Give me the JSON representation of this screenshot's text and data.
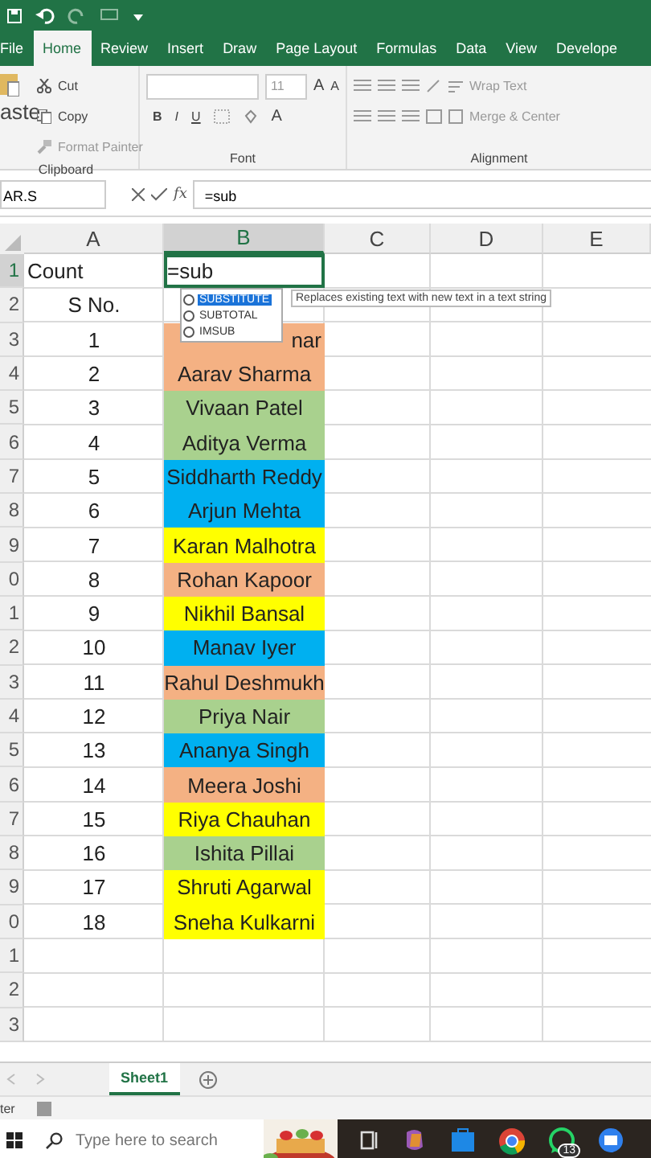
{
  "tabs": [
    {
      "label": "File",
      "selected": false
    },
    {
      "label": "Home",
      "selected": true
    },
    {
      "label": "Review",
      "selected": false
    },
    {
      "label": "Insert",
      "selected": false
    },
    {
      "label": "Draw",
      "selected": false
    },
    {
      "label": "Page Layout",
      "selected": false
    },
    {
      "label": "Formulas",
      "selected": false
    },
    {
      "label": "Data",
      "selected": false
    },
    {
      "label": "View",
      "selected": false
    },
    {
      "label": "Develope",
      "selected": false
    }
  ],
  "ribbon": {
    "paste": "aste",
    "cut": "Cut",
    "copy": "Copy",
    "format_painter": "Format Painter",
    "clipboard_label": "Clipboard",
    "font_size": "11",
    "bold": "B",
    "italic": "I",
    "underline": "U",
    "font_color": "A",
    "grow": "A",
    "shrink": "A",
    "font_label": "Font",
    "wrap": "Wrap Text",
    "merge": "Merge & Center",
    "alignment_label": "Alignment"
  },
  "formula_bar": {
    "name_box": "AR.S",
    "fx": "fx",
    "value": "=sub"
  },
  "columns": [
    {
      "label": "A",
      "selected": false
    },
    {
      "label": "B",
      "selected": true
    },
    {
      "label": "C",
      "selected": false
    },
    {
      "label": "D",
      "selected": false
    },
    {
      "label": "E",
      "selected": false
    }
  ],
  "rows": [
    {
      "number": "1",
      "selected": true,
      "a": "Count",
      "b": "=sub",
      "editing": true
    },
    {
      "number": "2",
      "selected": false,
      "a": "S No."
    },
    {
      "number": "3",
      "selected": false,
      "a": "1",
      "b": "nar",
      "color": "#f4b183",
      "partly_hidden": true
    },
    {
      "number": "4",
      "selected": false,
      "a": "2",
      "b": "Aarav Sharma",
      "color": "#f4b183"
    },
    {
      "number": "5",
      "selected": false,
      "a": "3",
      "b": "Vivaan Patel",
      "color": "#a9d18e"
    },
    {
      "number": "6",
      "selected": false,
      "a": "4",
      "b": "Aditya Verma",
      "color": "#a9d18e"
    },
    {
      "number": "7",
      "selected": false,
      "a": "5",
      "b": "Siddharth Reddy",
      "color": "#00b0f0"
    },
    {
      "number": "8",
      "selected": false,
      "a": "6",
      "b": "Arjun Mehta",
      "color": "#00b0f0"
    },
    {
      "number": "9",
      "selected": false,
      "a": "7",
      "b": "Karan Malhotra",
      "color": "#ffff00"
    },
    {
      "number": "0",
      "selected": false,
      "a": "8",
      "b": "Rohan Kapoor",
      "color": "#f4b183"
    },
    {
      "number": "1",
      "selected": false,
      "a": "9",
      "b": "Nikhil Bansal",
      "color": "#ffff00"
    },
    {
      "number": "2",
      "selected": false,
      "a": "10",
      "b": "Manav Iyer",
      "color": "#00b0f0"
    },
    {
      "number": "3",
      "selected": false,
      "a": "11",
      "b": "Rahul Deshmukh",
      "color": "#f4b183"
    },
    {
      "number": "4",
      "selected": false,
      "a": "12",
      "b": "Priya Nair",
      "color": "#a9d18e"
    },
    {
      "number": "5",
      "selected": false,
      "a": "13",
      "b": "Ananya Singh",
      "color": "#00b0f0"
    },
    {
      "number": "6",
      "selected": false,
      "a": "14",
      "b": "Meera Joshi",
      "color": "#f4b183"
    },
    {
      "number": "7",
      "selected": false,
      "a": "15",
      "b": "Riya Chauhan",
      "color": "#ffff00"
    },
    {
      "number": "8",
      "selected": false,
      "a": "16",
      "b": "Ishita Pillai",
      "color": "#a9d18e"
    },
    {
      "number": "9",
      "selected": false,
      "a": "17",
      "b": "Shruti Agarwal",
      "color": "#ffff00"
    },
    {
      "number": "0",
      "selected": false,
      "a": "18",
      "b": "Sneha Kulkarni",
      "color": "#ffff00"
    },
    {
      "number": "1",
      "selected": false
    },
    {
      "number": "2",
      "selected": false
    },
    {
      "number": "3",
      "selected": false
    }
  ],
  "autocomplete": {
    "items": [
      {
        "label": "SUBSTITUTE",
        "selected": true
      },
      {
        "label": "SUBTOTAL",
        "selected": false
      },
      {
        "label": "IMSUB",
        "selected": false
      }
    ],
    "tooltip": "Replaces existing text with new text in a text string"
  },
  "sheet_tabs": [
    {
      "label": "Sheet1",
      "selected": true
    }
  ],
  "status_bar": {
    "mode": "ter"
  },
  "taskbar": {
    "search_placeholder": "Type here to search",
    "badge": "13"
  }
}
